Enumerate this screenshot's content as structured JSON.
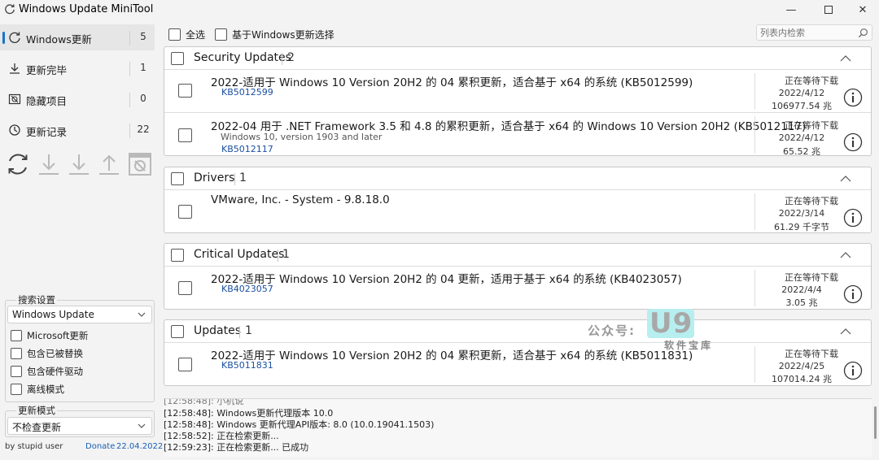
{
  "window": {
    "title": "Windows Update MiniTool",
    "minimize": "—",
    "close": "✕"
  },
  "sidebar": {
    "items": [
      {
        "label": "Windows更新",
        "count": "5",
        "icon": "refresh-icon"
      },
      {
        "label": "更新完毕",
        "count": "1",
        "icon": "download-done-icon"
      },
      {
        "label": "隐藏项目",
        "count": "0",
        "icon": "hidden-icon"
      },
      {
        "label": "更新记录",
        "count": "22",
        "icon": "history-icon"
      }
    ],
    "toolbar_icons": [
      "refresh-icon",
      "download-icon",
      "install-icon",
      "upload-icon",
      "hide-icon"
    ]
  },
  "search_settings": {
    "title": "搜索设置",
    "source": "Windows Update",
    "options": [
      {
        "label": "Microsoft更新",
        "checked": false
      },
      {
        "label": "包含已被替换",
        "checked": false
      },
      {
        "label": "包含硬件驱动",
        "checked": false
      },
      {
        "label": "离线模式",
        "checked": false
      }
    ]
  },
  "update_mode": {
    "title": "更新模式",
    "value": "不检查更新"
  },
  "footer": {
    "author": "by stupid user",
    "donate": "Donate",
    "date": "22.04.2022"
  },
  "toolbar": {
    "select_all": "全选",
    "based_on_windows": "基于Windows更新选择",
    "search_placeholder": "列表内检索"
  },
  "categories": [
    {
      "name": "Security Updates",
      "count": "2",
      "items": [
        {
          "title": "2022-适用于 Windows 10 Version 20H2 的 04 累积更新，适合基于 x64 的系统 (KB5012599)",
          "subtitle": "",
          "kb": "KB5012599",
          "status": "正在等待下载",
          "date": "2022/4/12",
          "size": "106977.54 兆"
        },
        {
          "title": "2022-04 用于 .NET Framework 3.5 和 4.8 的累积更新，适合基于 x64 的 Windows 10 Version 20H2 (KB5012117)",
          "subtitle": "Windows 10, version 1903 and later",
          "kb": "KB5012117",
          "status": "正在等待下载",
          "date": "2022/4/12",
          "size": "65.52 兆"
        }
      ]
    },
    {
      "name": "Drivers",
      "count": "1",
      "items": [
        {
          "title": "VMware, Inc. - System - 9.8.18.0",
          "subtitle": "",
          "kb": "",
          "status": "正在等待下载",
          "date": "2022/3/14",
          "size": "61.29 千字节"
        }
      ]
    },
    {
      "name": "Critical Updates",
      "count": "1",
      "items": [
        {
          "title": "2022-适用于 Windows 10 Version 20H2 的 04 更新，适用于基于 x64 的系统 (KB4023057)",
          "subtitle": "",
          "kb": "KB4023057",
          "status": "正在等待下载",
          "date": "2022/4/4",
          "size": "3.05 兆"
        }
      ]
    },
    {
      "name": "Updates",
      "count": "1",
      "items": [
        {
          "title": "2022-适用于 Windows 10 Version 20H2 的 04 累积更新，适合基于 x64 的系统 (KB5011831)",
          "subtitle": "",
          "kb": "KB5011831",
          "status": "正在等待下载",
          "date": "2022/4/25",
          "size": "107014.24 兆"
        }
      ]
    }
  ],
  "watermark": {
    "prefix": "公众号:",
    "logo": "U9",
    "sub": "软件宝库"
  },
  "log": [
    "[12:58:48]: Windows更新代理版本 10.0",
    "[12:58:48]: Windows 更新代理API版本: 8.0 (10.0.19041.1503)",
    "[12:58:52]: 正在检索更新...",
    "[12:59:23]: 正在检索更新... 已成功"
  ]
}
